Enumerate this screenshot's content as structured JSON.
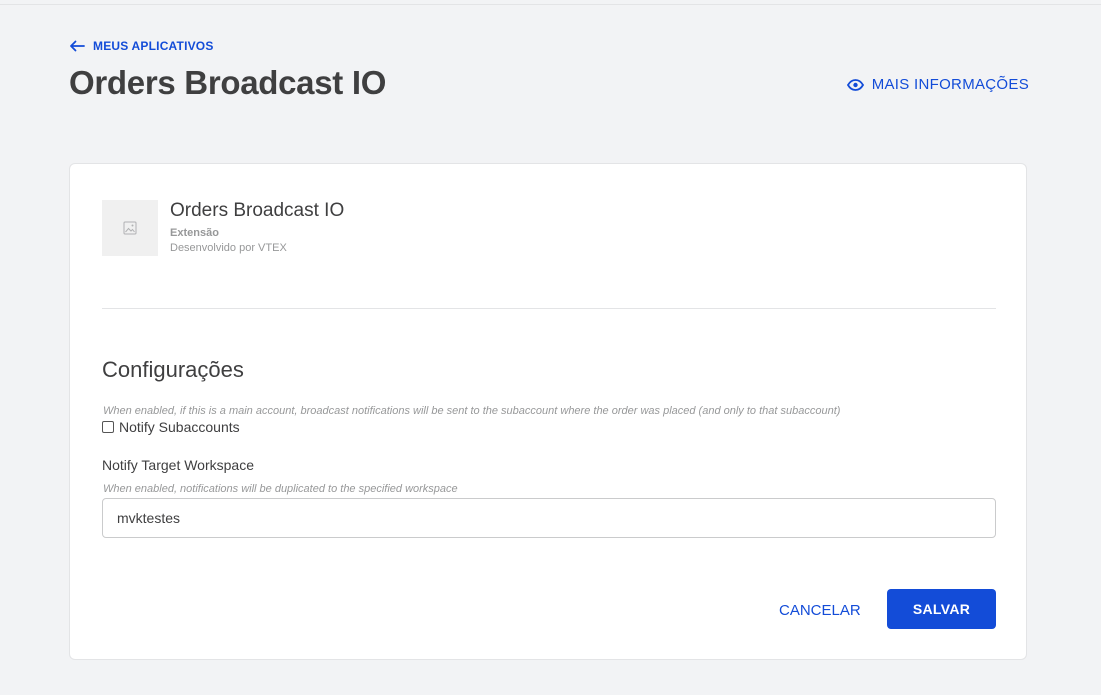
{
  "header": {
    "back_label": "MEUS APLICATIVOS",
    "title": "Orders Broadcast IO",
    "more_info_label": "MAIS INFORMAÇÕES"
  },
  "app": {
    "name": "Orders Broadcast IO",
    "type": "Extensão",
    "developer": "Desenvolvido por VTEX"
  },
  "settings": {
    "section_title": "Configurações",
    "notify_subaccounts": {
      "help": "When enabled, if this is a main account, broadcast notifications will be sent to the subaccount where the order was placed (and only to that subaccount)",
      "label": "Notify Subaccounts",
      "checked": false
    },
    "notify_target_workspace": {
      "label": "Notify Target Workspace",
      "help": "When enabled, notifications will be duplicated to the specified workspace",
      "value": "mvktestes"
    }
  },
  "actions": {
    "cancel_label": "CANCELAR",
    "save_label": "SALVAR"
  },
  "colors": {
    "accent": "#134cd8",
    "background": "#f2f3f5",
    "text": "#3f3f40",
    "muted": "#979899"
  }
}
